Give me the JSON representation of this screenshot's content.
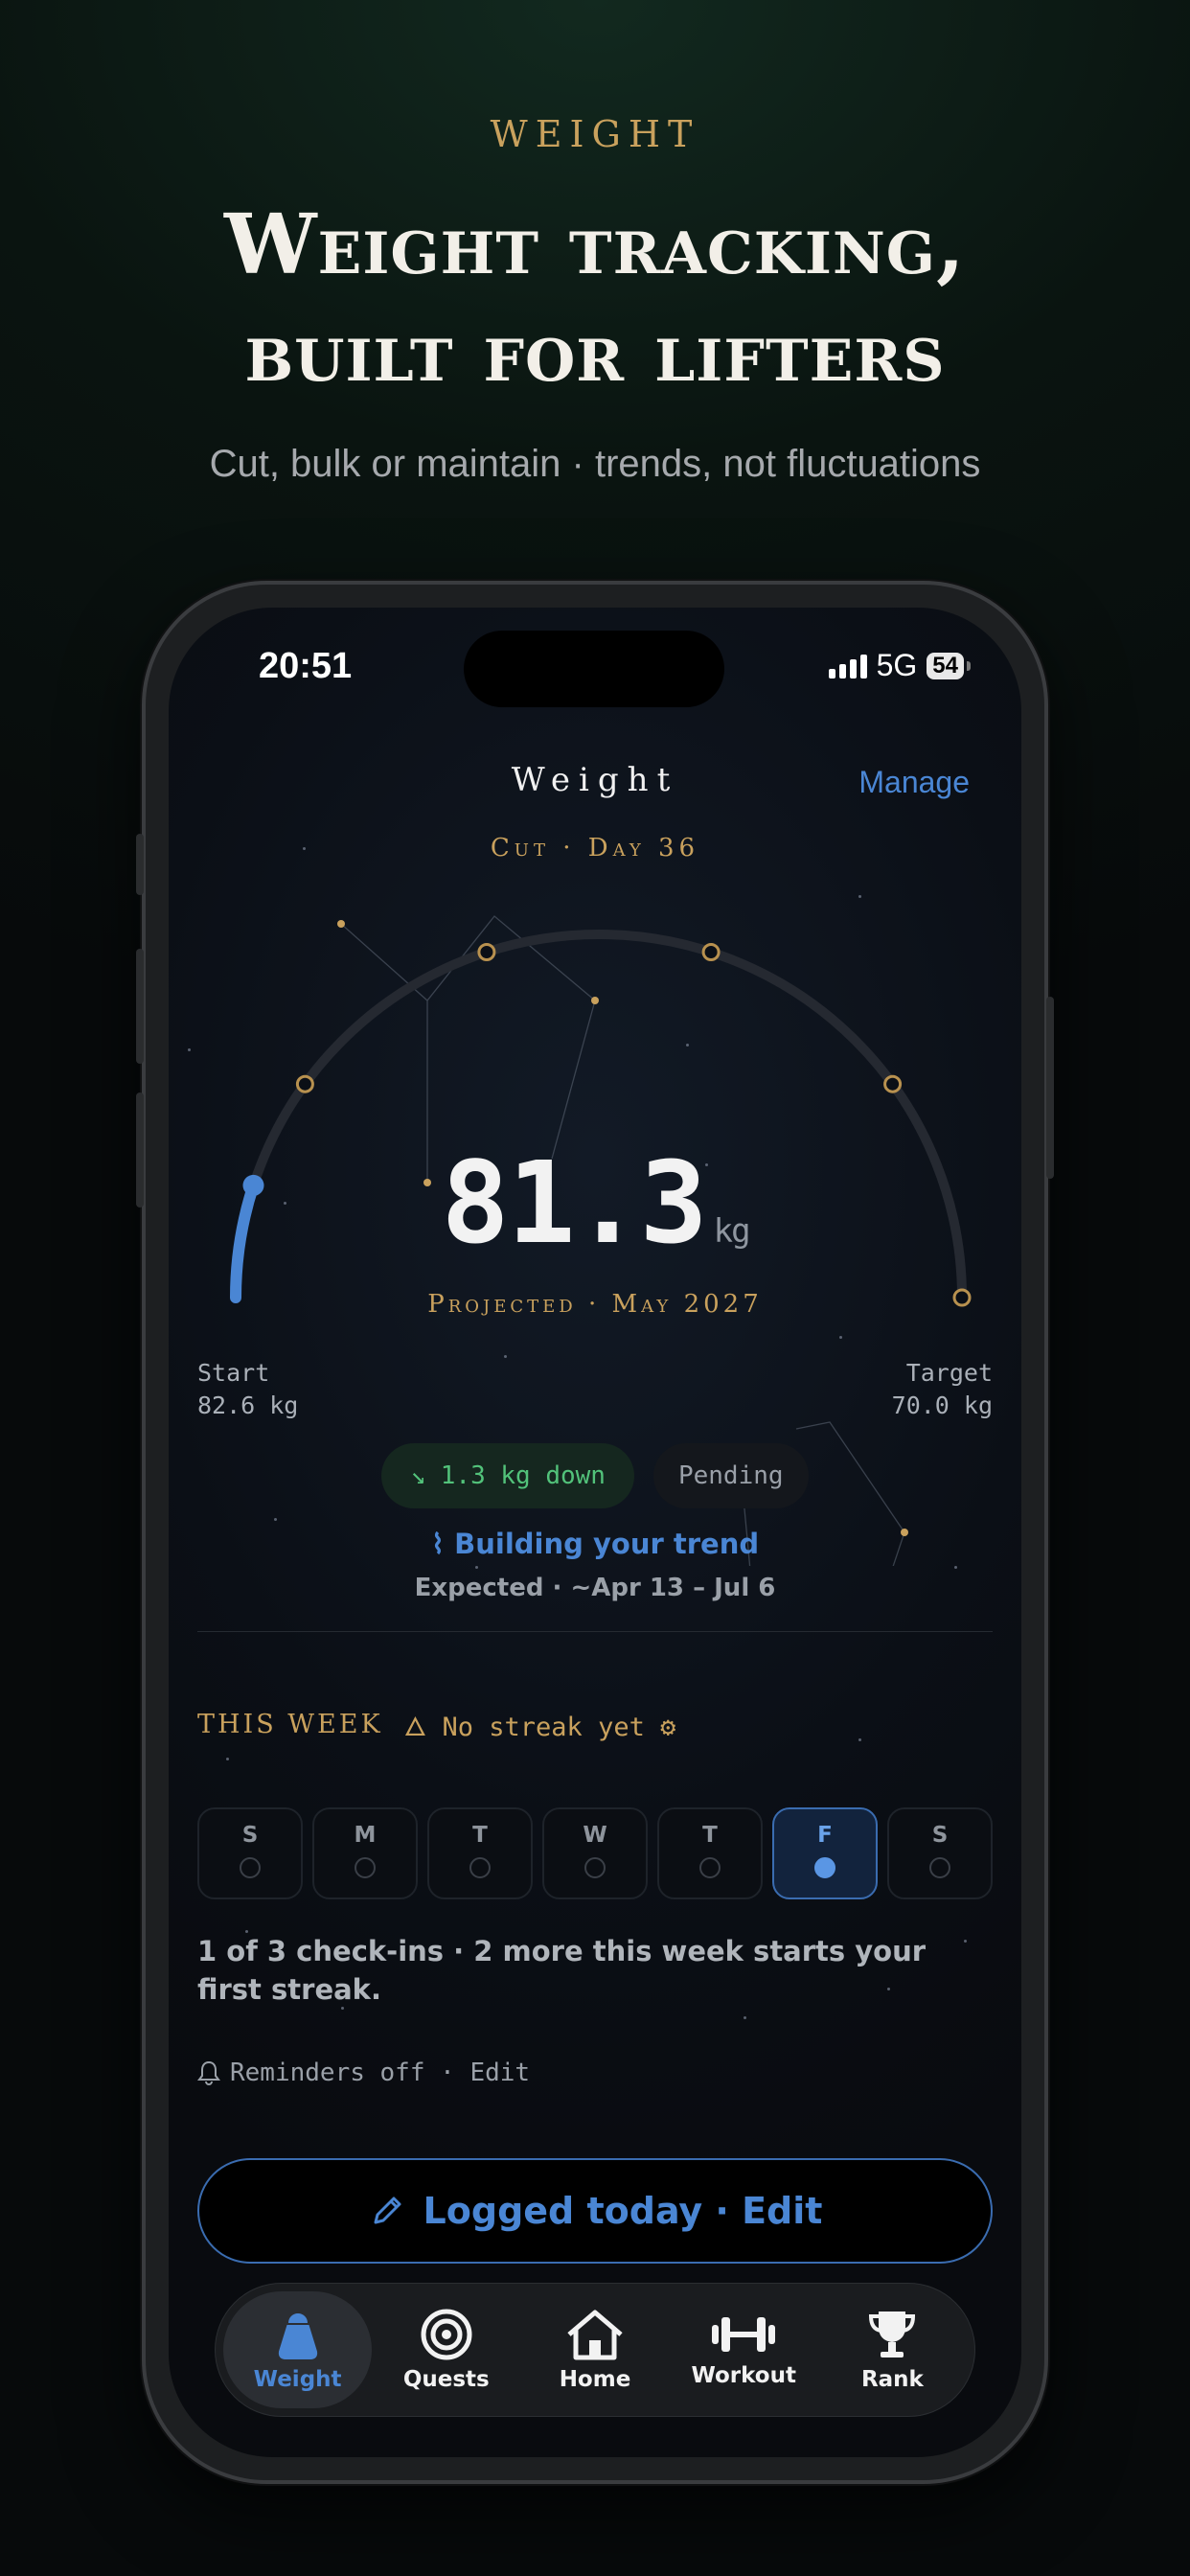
{
  "hero": {
    "eyebrow": "WEIGHT",
    "title_line1": "Weight tracking,",
    "title_line2": "built for lifters",
    "subtitle": "Cut, bulk or maintain · trends, not fluctuations"
  },
  "status_bar": {
    "time": "20:51",
    "network": "5G",
    "battery": "54"
  },
  "screen": {
    "title": "Weight",
    "manage_label": "Manage",
    "phase": "Cut · Day 36",
    "current_weight": "81.3",
    "unit": "kg",
    "projected": "Projected · May 2027",
    "progress_fraction": 0.1,
    "start_label": "Start",
    "start_value": "82.6 kg",
    "target_label": "Target",
    "target_value": "70.0 kg",
    "change_pill": "1.3 kg down",
    "pending_pill": "Pending",
    "trend_text": "Building your trend",
    "expected_text": "Expected · ~Apr 13 – Jul 6",
    "week_title": "THIS WEEK",
    "streak_text": "No streak yet",
    "days": [
      {
        "letter": "S",
        "state": "empty"
      },
      {
        "letter": "M",
        "state": "empty"
      },
      {
        "letter": "T",
        "state": "empty"
      },
      {
        "letter": "W",
        "state": "empty"
      },
      {
        "letter": "T",
        "state": "empty"
      },
      {
        "letter": "F",
        "state": "done"
      },
      {
        "letter": "S",
        "state": "empty"
      }
    ],
    "checkins_text": "1 of 3 check-ins · 2 more this week starts your first streak.",
    "reminders_text": "Reminders off · Edit",
    "logged_button": "Logged today · Edit"
  },
  "tabs": [
    {
      "label": "Weight",
      "icon": "kettlebell-icon",
      "active": true
    },
    {
      "label": "Quests",
      "icon": "target-icon",
      "active": false
    },
    {
      "label": "Home",
      "icon": "home-icon",
      "active": false
    },
    {
      "label": "Workout",
      "icon": "dumbbell-icon",
      "active": false
    },
    {
      "label": "Rank",
      "icon": "trophy-icon",
      "active": false
    }
  ],
  "colors": {
    "accent_blue": "#4a86d4",
    "gold": "#c9a15d",
    "green": "#52c27a",
    "background": "#090b0f"
  }
}
